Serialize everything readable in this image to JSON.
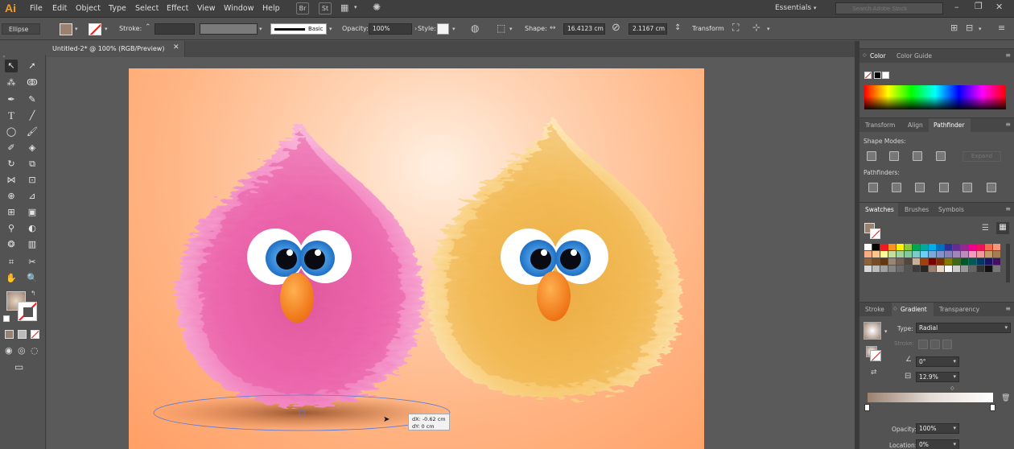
{
  "app": {
    "logo": "Ai"
  },
  "menubar": {
    "items": [
      "File",
      "Edit",
      "Object",
      "Type",
      "Select",
      "Effect",
      "View",
      "Window",
      "Help"
    ],
    "icon_buttons": [
      "bridge-icon",
      "stock-icon",
      "arrange-documents-icon",
      "gpu-performance-icon"
    ],
    "workspace": "Essentials",
    "search_placeholder": "Search Adobe Stock"
  },
  "controlbar": {
    "selection": "Ellipse",
    "stroke_label": "Stroke:",
    "brush": "Basic",
    "opacity_label": "Opacity:",
    "opacity_value": "100%",
    "style_label": "Style:",
    "shape_label": "Shape:",
    "width": "16.4123 cm",
    "height": "2.1167 cm",
    "transform_label": "Transform"
  },
  "document": {
    "tab_title": "Untitled-2* @ 100% (RGB/Preview)"
  },
  "canvas": {
    "measure_dx": "dX: -0.62 cm",
    "measure_dy": "dY: 0 cm",
    "colors": {
      "pink_fur": "#ef6fb2",
      "yellow_fur": "#f5c05e",
      "eye_blue": "#2f8fdc",
      "beak": "#f98a24"
    }
  },
  "panels": {
    "color_tabs": [
      "Color",
      "Color Guide"
    ],
    "pathfinder_tabs": [
      "Transform",
      "Align",
      "Pathfinder"
    ],
    "shape_modes_label": "Shape Modes:",
    "expand_label": "Expand",
    "pathfinders_label": "Pathfinders:",
    "swatch_tabs": [
      "Swatches",
      "Brushes",
      "Symbols"
    ],
    "gradient_tabs": [
      "Stroke",
      "Gradient",
      "Transparency"
    ],
    "type_label": "Type:",
    "type_value": "Radial",
    "stroke_label": "Stroke:",
    "angle_value": "0°",
    "aspect_value": "12.9%",
    "opacity_label": "Opacity:",
    "opacity_value": "100%",
    "location_label": "Location:",
    "location_value": "0%"
  }
}
